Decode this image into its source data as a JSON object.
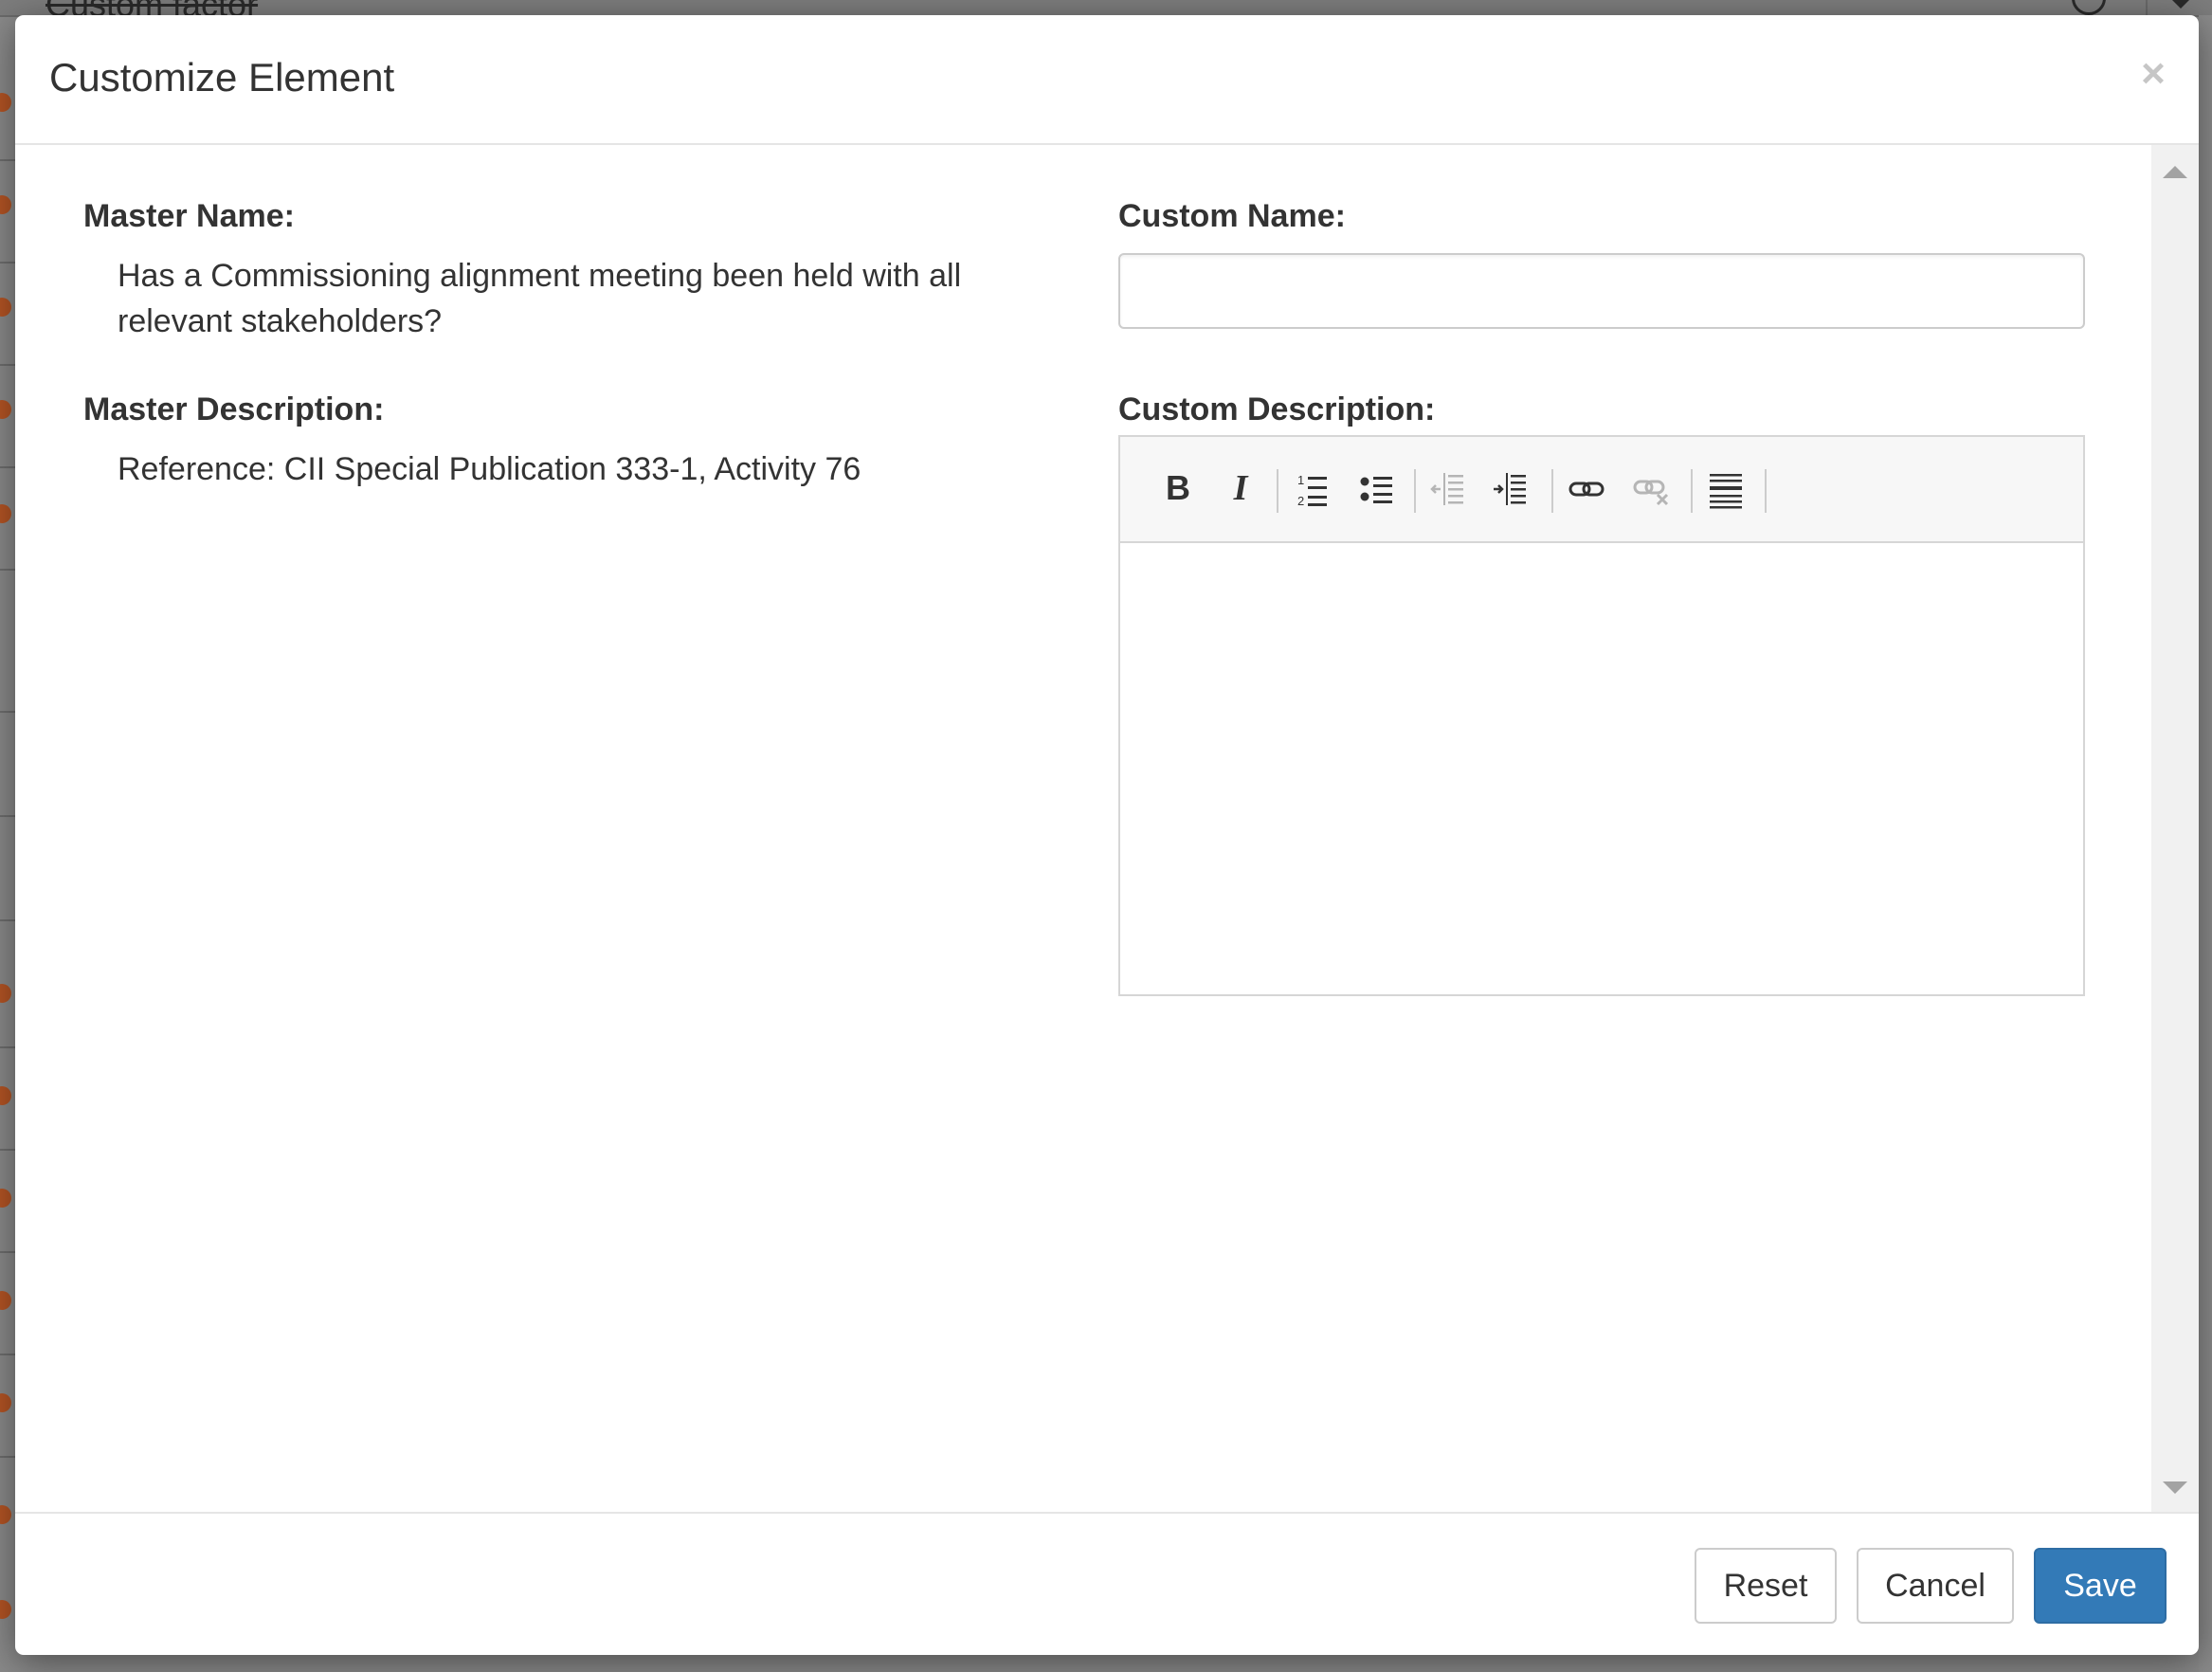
{
  "background": {
    "header_text": "Custom factor"
  },
  "modal": {
    "title": "Customize Element",
    "close_symbol": "×",
    "master_name_label": "Master Name:",
    "master_name_value": "Has a Commissioning alignment meeting been held with all relevant stakeholders?",
    "master_description_label": "Master Description:",
    "master_description_value": "Reference: CII Special Publication 333-1, Activity 76",
    "custom_name_label": "Custom Name:",
    "custom_name_value": "",
    "custom_description_label": "Custom Description:",
    "custom_description_value": "",
    "toolbar": [
      "bold-icon",
      "italic-icon",
      "ordered-list-icon",
      "unordered-list-icon",
      "outdent-icon",
      "indent-icon",
      "link-icon",
      "unlink-icon",
      "horizontal-rule-icon"
    ]
  },
  "footer": {
    "reset_label": "Reset",
    "cancel_label": "Cancel",
    "save_label": "Save"
  },
  "colors": {
    "primary": "#337ab7",
    "background_dot": "#b45424",
    "text": "#333333"
  }
}
